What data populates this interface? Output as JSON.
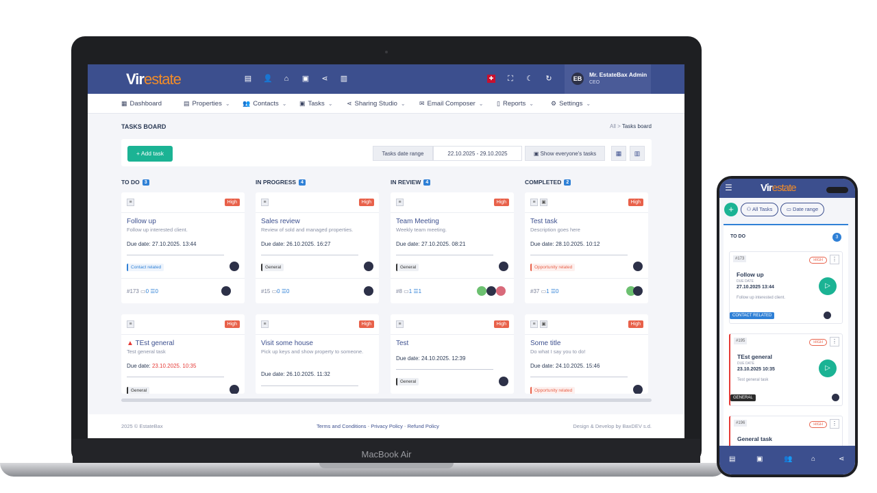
{
  "device": {
    "laptop_label": "MacBook Air"
  },
  "header": {
    "logo_a": "Vir",
    "logo_b": "estate",
    "user_name": "Mr. EstateBax Admin",
    "user_role": "CEO",
    "avatar_text": "EB"
  },
  "menu": [
    {
      "label": "Dashboard",
      "icon": "▦"
    },
    {
      "label": "Properties",
      "icon": "▤"
    },
    {
      "label": "Contacts",
      "icon": "👥"
    },
    {
      "label": "Tasks",
      "icon": "▣"
    },
    {
      "label": "Sharing Studio",
      "icon": "⋖"
    },
    {
      "label": "Email Composer",
      "icon": "✉"
    },
    {
      "label": "Reports",
      "icon": "▯"
    },
    {
      "label": "Settings",
      "icon": "⚙"
    }
  ],
  "page": {
    "title": "TASKS BOARD",
    "crumb_root": "All",
    "crumb_sep": ">",
    "crumb_current": "Tasks board"
  },
  "toolbar": {
    "add_task": "+ Add task",
    "date_range_label": "Tasks date range",
    "date_range_value": "22.10.2025 - 29.10.2025",
    "everyone": "Show everyone's tasks"
  },
  "columns": [
    {
      "title": "TO DO",
      "count": "3"
    },
    {
      "title": "IN PROGRESS",
      "count": "4"
    },
    {
      "title": "IN REVIEW",
      "count": "4"
    },
    {
      "title": "COMPLETED",
      "count": "2"
    }
  ],
  "cards_row1": [
    {
      "priority": "High",
      "title": "Follow up",
      "desc": "Follow up interested client.",
      "due_label": "Due date:",
      "due": "27.10.2025. 13:44",
      "tag": "Contact related",
      "id": "#173",
      "comments": "0",
      "subtasks": "0"
    },
    {
      "priority": "High",
      "title": "Sales review",
      "desc": "Review of sold and managed properties.",
      "due_label": "Due date:",
      "due": "26.10.2025. 16:27",
      "tag": "General",
      "id": "#15",
      "comments": "0",
      "subtasks": "0"
    },
    {
      "priority": "High",
      "title": "Team Meeting",
      "desc": "Weekly team meeting.",
      "due_label": "Due date:",
      "due": "27.10.2025. 08:21",
      "tag": "General",
      "id": "#8",
      "comments": "1",
      "subtasks": "1"
    },
    {
      "priority": "High",
      "title": "Test task",
      "desc": "Description goes here",
      "due_label": "Due date:",
      "due": "28.10.2025. 10:12",
      "tag": "Opportunity related",
      "id": "#37",
      "comments": "1",
      "subtasks": "0"
    }
  ],
  "cards_row2": [
    {
      "priority": "High",
      "title": "TEst general",
      "desc": "Test general task",
      "due_label": "Due date:",
      "due": "23.10.2025. 10:35",
      "tag": "General"
    },
    {
      "priority": "High",
      "title": "Visit some house",
      "desc": "Pick up keys and show property to someone.",
      "due_label": "Due date:",
      "due": "26.10.2025. 11:32"
    },
    {
      "priority": "High",
      "title": "Test",
      "desc": "",
      "due_label": "Due date:",
      "due": "24.10.2025. 12:39",
      "tag": "General"
    },
    {
      "priority": "High",
      "title": "Some title",
      "desc": "Do what I say you to do!",
      "due_label": "Due date:",
      "due": "24.10.2025. 15:46",
      "tag": "Opportunity related"
    }
  ],
  "footer": {
    "copyright": "2025 © EstateBax",
    "terms": "Terms and Conditions",
    "sep": "-",
    "privacy": "Privacy Policy",
    "refund": "Refund Policy",
    "credit": "Design & Develop by BaxDEV s.d."
  },
  "phone": {
    "all_tasks": "All Tasks",
    "date_range": "Date range",
    "column": "TO DO",
    "column_count": "3",
    "due_small": "DUE DATE",
    "cards": [
      {
        "id": "#173",
        "priority": "HIGH",
        "title": "Follow up",
        "due": "27.10.2025 13:44",
        "desc": "Follow up interested client.",
        "tag": "CONTACT RELATED"
      },
      {
        "id": "#195",
        "priority": "HIGH",
        "title": "TEst general",
        "due": "23.10.2025 10:35",
        "desc": "Test general task",
        "tag": "GENERAL"
      },
      {
        "id": "#196",
        "priority": "HIGH",
        "title": "General task"
      }
    ]
  },
  "colors": {
    "header": "#3c4f8e",
    "accent": "#1bb394",
    "high": "#e8614a",
    "count": "#2f80d6",
    "logo_orange": "#f28c28"
  }
}
